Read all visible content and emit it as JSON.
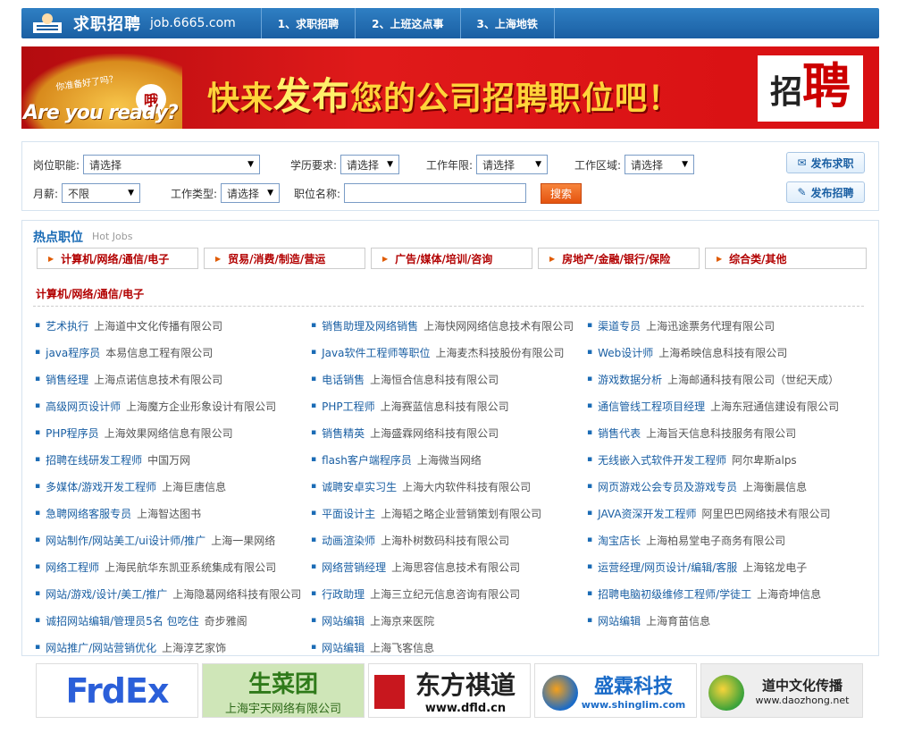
{
  "header": {
    "brand": "求职招聘",
    "domain": "job.6665.com",
    "nav": [
      "1、求职招聘",
      "2、上班这点事",
      "3、上海地铁"
    ]
  },
  "banner": {
    "sub": "你准备好了吗？",
    "tag": "哦",
    "ready": "Are you ready?",
    "slogan_a": "快来",
    "slogan_b": "发布",
    "slogan_c": "您的公司招聘职位吧！",
    "zhao_a": "招",
    "zhao_b": "聘"
  },
  "search": {
    "job_label": "岗位职能:",
    "job_value": "请选择",
    "edu_label": "学历要求:",
    "edu_value": "请选择",
    "years_label": "工作年限:",
    "years_value": "请选择",
    "area_label": "工作区域:",
    "area_value": "请选择",
    "salary_label": "月薪:",
    "salary_value": "不限",
    "type_label": "工作类型:",
    "type_value": "请选择",
    "name_label": "职位名称:",
    "name_value": "",
    "search_btn": "搜索",
    "post_resume": "发布求职",
    "post_job": "发布招聘"
  },
  "hot": {
    "title": "热点职位",
    "title_en": "Hot Jobs",
    "categories": [
      "计算机/网络/通信/电子",
      "贸易/消费/制造/营运",
      "广告/媒体/培训/咨询",
      "房地产/金融/银行/保险",
      "综合类/其他"
    ],
    "subhead": "计算机/网络/通信/电子",
    "col1": [
      {
        "t": "艺术执行",
        "c": "上海道中文化传播有限公司"
      },
      {
        "t": "java程序员",
        "c": "本易信息工程有限公司"
      },
      {
        "t": "销售经理",
        "c": "上海点诺信息技术有限公司"
      },
      {
        "t": "高级网页设计师",
        "c": "上海魔方企业形象设计有限公司"
      },
      {
        "t": "PHP程序员",
        "c": "上海效果网络信息有限公司"
      },
      {
        "t": "招聘在线研发工程师",
        "c": "中国万网"
      },
      {
        "t": "多媒体/游戏开发工程师",
        "c": "上海巨唐信息"
      },
      {
        "t": "急聘网络客服专员",
        "c": "上海智达图书"
      },
      {
        "t": "网站制作/网站美工/ui设计师/推广",
        "c": "上海一果网络"
      },
      {
        "t": "网络工程师",
        "c": "上海民航华东凯亚系统集成有限公司"
      },
      {
        "t": "网站/游戏/设计/美工/推广",
        "c": "上海隐葛网络科技有限公司"
      },
      {
        "t": "诚招网站编辑/管理员5名 包吃住",
        "c": "奇步雅阁"
      },
      {
        "t": "网站推广/网站营销优化",
        "c": "上海淳艺家饰"
      }
    ],
    "col2": [
      {
        "t": "销售助理及网络销售",
        "c": "上海快网网络信息技术有限公司"
      },
      {
        "t": "Java软件工程师等职位",
        "c": "上海麦杰科技股份有限公司"
      },
      {
        "t": "电话销售",
        "c": "上海恒合信息科技有限公司"
      },
      {
        "t": "PHP工程师",
        "c": "上海赛蓝信息科技有限公司"
      },
      {
        "t": "销售精英",
        "c": "上海盛霖网络科技有限公司"
      },
      {
        "t": "flash客户端程序员",
        "c": "上海微当网络"
      },
      {
        "t": "诚聘安卓实习生",
        "c": "上海大内软件科技有限公司"
      },
      {
        "t": "平面设计主",
        "c": "上海韬之略企业营销策划有限公司"
      },
      {
        "t": "动画渲染师",
        "c": "上海朴树数码科技有限公司"
      },
      {
        "t": "网络营销经理",
        "c": "上海思容信息技术有限公司"
      },
      {
        "t": "行政助理",
        "c": "上海三立纪元信息咨询有限公司"
      },
      {
        "t": "网站编辑",
        "c": "上海京来医院"
      },
      {
        "t": "网站编辑",
        "c": "上海飞客信息"
      }
    ],
    "col3": [
      {
        "t": "渠道专员",
        "c": "上海迅途票务代理有限公司"
      },
      {
        "t": "Web设计师",
        "c": "上海希映信息科技有限公司"
      },
      {
        "t": "游戏数据分析",
        "c": "上海邮通科技有限公司（世纪天成）"
      },
      {
        "t": "通信管线工程项目经理",
        "c": "上海东冠通信建设有限公司"
      },
      {
        "t": "销售代表",
        "c": "上海旨天信息科技服务有限公司"
      },
      {
        "t": "无线嵌入式软件开发工程师",
        "c": "阿尔卑斯alps"
      },
      {
        "t": "网页游戏公会专员及游戏专员",
        "c": "上海衡晨信息"
      },
      {
        "t": "JAVA资深开发工程师",
        "c": "阿里巴巴网络技术有限公司"
      },
      {
        "t": "淘宝店长",
        "c": "上海柏易堂电子商务有限公司"
      },
      {
        "t": "运营经理/网页设计/编辑/客服",
        "c": "上海铭龙电子"
      },
      {
        "t": "招聘电脑初级维修工程师/学徒工",
        "c": "上海奇坤信息"
      },
      {
        "t": "网站编辑",
        "c": "上海育苗信息"
      }
    ]
  },
  "logos": {
    "l1": "FrdEx",
    "l2a": "生菜团",
    "l2b": "上海宇天网络有限公司",
    "l3a": "东方祺道",
    "l3b": "www.dfld.cn",
    "l4a": "盛霖科技",
    "l4b": "www.shinglim.com",
    "l5a": "道中文化传播",
    "l5b": "www.daozhong.net"
  }
}
